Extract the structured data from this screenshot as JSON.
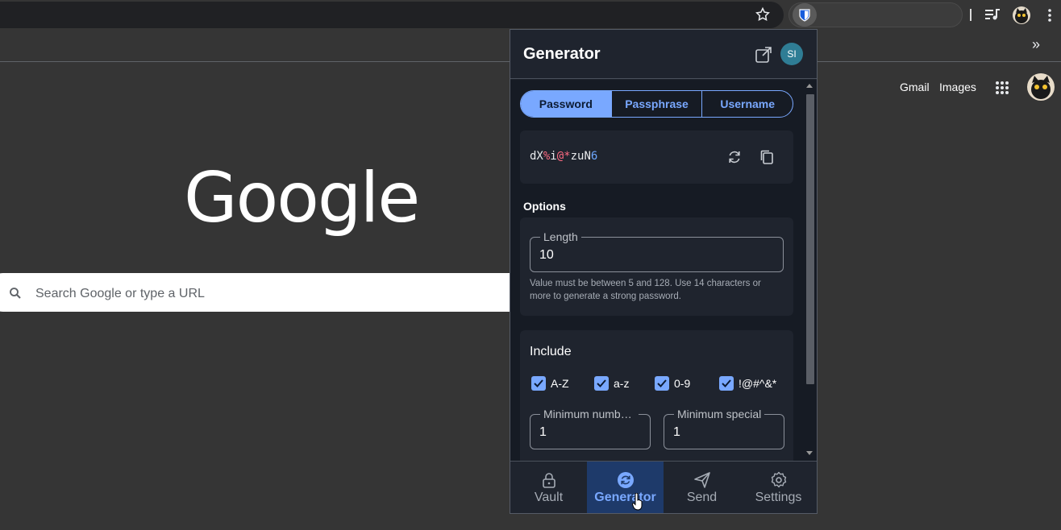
{
  "browser": {
    "profile_icon": "avatar-cat",
    "extension_icon": "bitwarden-shield-icon"
  },
  "ntp": {
    "gmail": "Gmail",
    "images": "Images",
    "logo": "Google",
    "search_placeholder": "Search Google or type a URL"
  },
  "popup": {
    "title": "Generator",
    "avatar_initials": "SI",
    "tabs": [
      {
        "label": "Password",
        "active": true
      },
      {
        "label": "Passphrase",
        "active": false
      },
      {
        "label": "Username",
        "active": false
      }
    ],
    "password": {
      "parts": [
        {
          "text": "dX",
          "kind": "letter"
        },
        {
          "text": "%",
          "kind": "special"
        },
        {
          "text": "i",
          "kind": "letter"
        },
        {
          "text": "@*",
          "kind": "special"
        },
        {
          "text": "zuN",
          "kind": "letter"
        },
        {
          "text": "6",
          "kind": "number"
        }
      ]
    },
    "options_label": "Options",
    "length": {
      "label": "Length",
      "value": "10",
      "hint": "Value must be between 5 and 128. Use 14 characters or more to generate a strong password."
    },
    "include": {
      "title": "Include",
      "checkboxes": [
        {
          "label": "A-Z",
          "checked": true
        },
        {
          "label": "a-z",
          "checked": true
        },
        {
          "label": "0-9",
          "checked": true
        },
        {
          "label": "!@#^&*",
          "checked": true
        }
      ],
      "min_numbers": {
        "label": "Minimum numbers",
        "value": "1"
      },
      "min_special": {
        "label": "Minimum special",
        "value": "1"
      }
    },
    "nav": [
      {
        "label": "Vault",
        "icon": "lock-icon",
        "active": false
      },
      {
        "label": "Generator",
        "icon": "generator-icon",
        "active": true
      },
      {
        "label": "Send",
        "icon": "send-icon",
        "active": false
      },
      {
        "label": "Settings",
        "icon": "gear-icon",
        "active": false
      }
    ]
  },
  "colors": {
    "accent": "#79a8ff",
    "special_char": "#ff6b82",
    "number_char": "#6ea8ff"
  }
}
